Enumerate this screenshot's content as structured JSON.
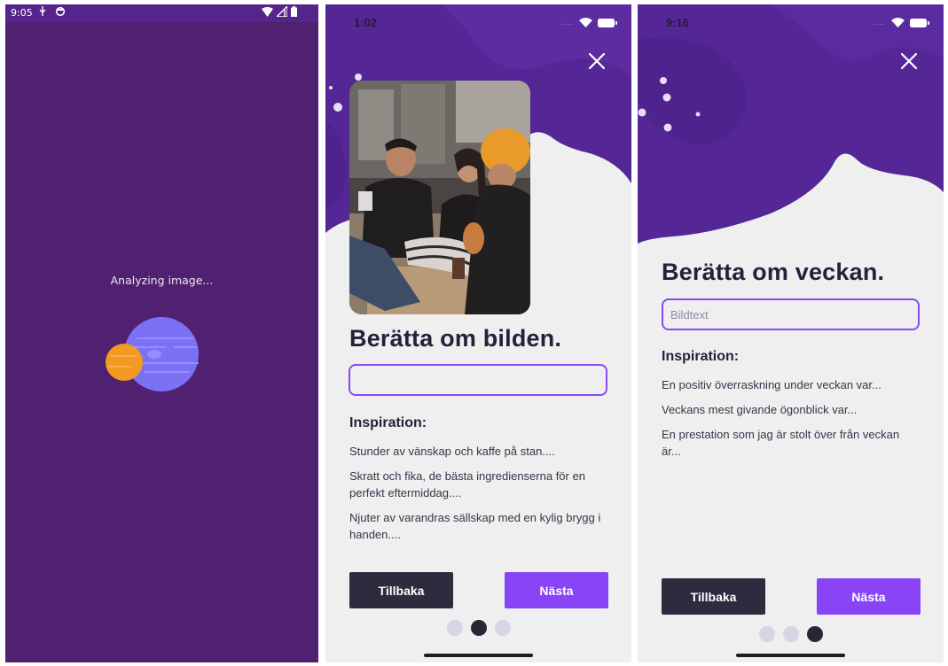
{
  "screen1": {
    "status_time": "9:05",
    "analyzing_label": "Analyzing image..."
  },
  "screen2": {
    "status_time": "1:02",
    "heading": "Berätta om bilden.",
    "input_value": "",
    "inspiration_title": "Inspiration:",
    "inspiration_items": [
      "Stunder av vänskap och kaffe på stan....",
      "Skratt och fika, de bästa ingredienserna för en perfekt eftermiddag....",
      "Njuter av varandras sällskap med en kylig brygg i handen...."
    ],
    "back_label": "Tillbaka",
    "next_label": "Nästa",
    "active_page": 2
  },
  "screen3": {
    "status_time": "9:16",
    "heading": "Berätta om veckan.",
    "input_placeholder": "Bildtext",
    "inspiration_title": "Inspiration:",
    "inspiration_items": [
      "En positiv överraskning under veckan var...",
      "Veckans mest givande ögonblick var...",
      "En prestation som jag är stolt över från veckan är..."
    ],
    "back_label": "Tillbaka",
    "next_label": "Nästa",
    "active_page": 3
  },
  "colors": {
    "purple_dark": "#4f2170",
    "purple_wave": "#5a2597",
    "accent": "#8844f5",
    "button_dark": "#2f2a3d",
    "background": "#efeff0"
  },
  "icons": [
    "close-icon",
    "wifi-icon",
    "battery-icon",
    "planet-icon"
  ]
}
